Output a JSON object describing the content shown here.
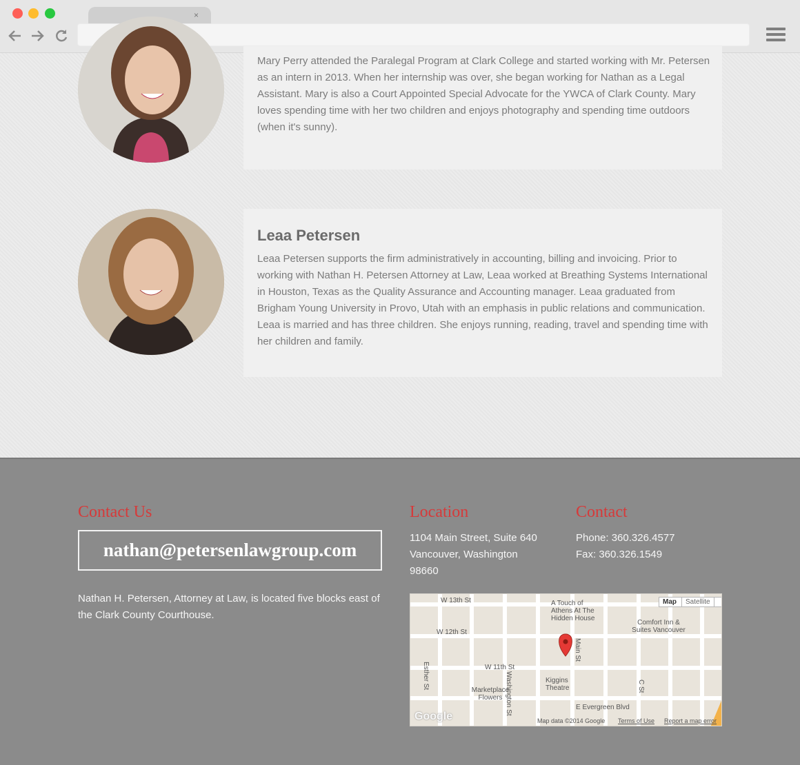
{
  "browser": {
    "tab_close": "×",
    "back_icon": "arrow-left-icon",
    "forward_icon": "arrow-right-icon",
    "reload_icon": "reload-icon",
    "menu_icon": "hamburger-menu-icon"
  },
  "team": [
    {
      "name": "",
      "bio": "Mary Perry attended the Paralegal Program at Clark College and started working with Mr. Petersen as an intern in 2013. When her internship was over, she began working for Nathan as a Legal Assistant. Mary is also a Court Appointed Special Advocate for the YWCA of Clark County. Mary loves spending time with her two children and enjoys photography and spending time outdoors (when it's sunny)."
    },
    {
      "name": "Leaa Petersen",
      "bio": "Leaa Petersen supports the firm administratively in accounting, billing and invoicing. Prior to working with Nathan H. Petersen Attorney at Law, Leaa worked at Breathing Systems International in Houston, Texas as the Quality Assurance and Accounting manager. Leaa graduated from Brigham Young University in Provo, Utah with an emphasis in public relations and communication. Leaa is married and has three children. She enjoys running, reading, travel and spending time with her children and family."
    }
  ],
  "footer": {
    "contact_us": {
      "heading": "Contact Us",
      "email": "nathan@petersenlawgroup.com",
      "about": "Nathan H. Petersen, Attorney at Law, is located five blocks east of the Clark County Courthouse."
    },
    "location": {
      "heading": "Location",
      "line1": "1104 Main Street, Suite 640",
      "line2": "Vancouver, Washington",
      "line3": "98660"
    },
    "contact": {
      "heading": "Contact",
      "phone": "Phone: 360.326.4577",
      "fax": "Fax: 360.326.1549"
    },
    "map": {
      "map_button": "Map",
      "satellite_button": "Satellite",
      "labels": {
        "w13": "W 13th St",
        "w12": "W 12th St",
        "w11": "W 11th St",
        "washington": "Washington St",
        "main": "Main St",
        "esther": "Esther St",
        "c": "C St",
        "evergreen": "E Evergreen Blvd",
        "athens": "A Touch of Athens At The Hidden House",
        "comfort": "Comfort Inn & Suites Vancouver",
        "kiggins": "Kiggins Theatre",
        "marketplace": "Marketplace Flowers"
      },
      "logo": "Google",
      "attribution": "Map data ©2014 Google",
      "terms": "Terms of Use",
      "report": "Report a map error"
    }
  }
}
